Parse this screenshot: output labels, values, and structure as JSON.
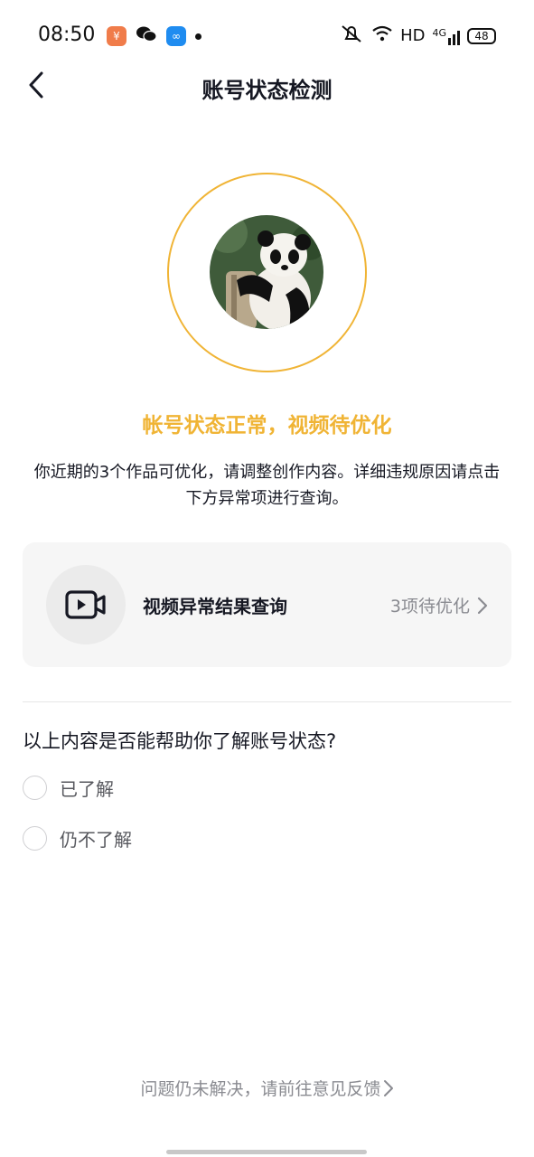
{
  "status_bar": {
    "time": "08:50",
    "network": "HD",
    "signal": "4G",
    "battery": "48"
  },
  "nav": {
    "title": "账号状态检测"
  },
  "hero": {
    "headline": "帐号状态正常，视频待优化",
    "description": "你近期的3个作品可优化，请调整创作内容。详细违规原因请点击下方异常项进行查询。",
    "ring_color": "#f0b435"
  },
  "result_card": {
    "title": "视频异常结果查询",
    "meta": "3项待优化"
  },
  "survey": {
    "question": "以上内容是否能帮助你了解账号状态?",
    "options": [
      {
        "label": "已了解"
      },
      {
        "label": "仍不了解"
      }
    ]
  },
  "footer": {
    "feedback": "问题仍未解决，请前往意见反馈"
  },
  "colors": {
    "accent": "#f0b435",
    "text": "#161823",
    "muted": "#8a8b91"
  }
}
